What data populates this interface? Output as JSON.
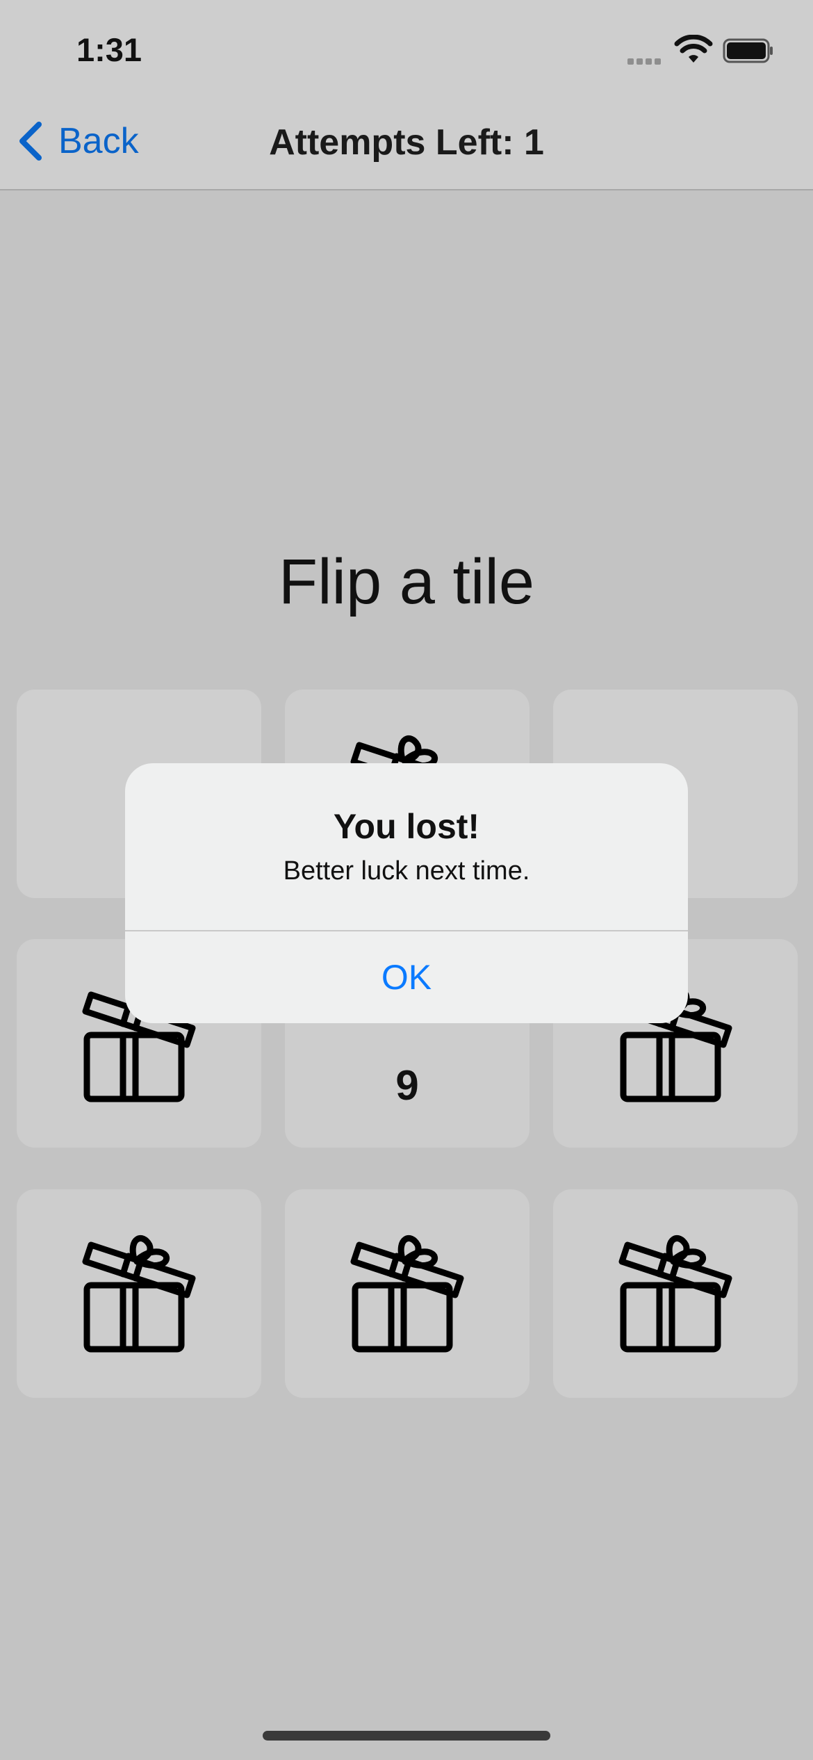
{
  "status_bar": {
    "time": "1:31"
  },
  "nav": {
    "back_label": "Back",
    "title": "Attempts Left: 1"
  },
  "main": {
    "heading": "Flip a tile"
  },
  "tiles": [
    {
      "content": "blank"
    },
    {
      "content": "gift-icon"
    },
    {
      "content": "blank"
    },
    {
      "content": "gift-icon"
    },
    {
      "content": "number",
      "value": "9"
    },
    {
      "content": "gift-icon"
    },
    {
      "content": "gift-icon"
    },
    {
      "content": "gift-icon"
    },
    {
      "content": "gift-icon"
    }
  ],
  "alert": {
    "title": "You lost!",
    "message": "Better luck next time.",
    "ok_label": "OK"
  },
  "colors": {
    "accent": "#0a7aff",
    "back": "#0a63c9",
    "background": "#c3c3c3"
  }
}
